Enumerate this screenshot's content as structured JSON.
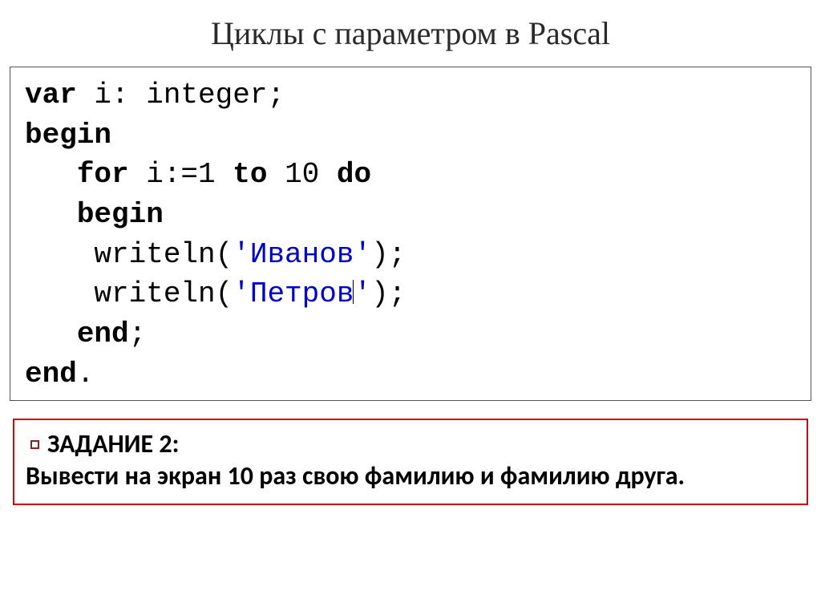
{
  "title": "Циклы с параметром в Pascal",
  "code": {
    "l1_kw1": "var",
    "l1_rest": " i: integer;",
    "l2_kw": "begin",
    "l3_kw1": "for",
    "l3_mid": " i:=1 ",
    "l3_kw2": "to",
    "l3_mid2": " 10 ",
    "l3_kw3": "do",
    "l4_kw": "begin",
    "l5_pre": "    writeln(",
    "l5_str": "'Иванов'",
    "l5_post": ");",
    "l6_pre": "    writeln(",
    "l6_str_a": "'Петров",
    "l6_str_b": "'",
    "l6_post": ");",
    "l7_kw": "end",
    "l7_post": ";",
    "l8_kw": "end",
    "l8_post": "."
  },
  "task": {
    "label": "ЗАДАНИЕ 2:",
    "text": "Вывести на экран 10 раз свою фамилию и фамилию друга."
  }
}
